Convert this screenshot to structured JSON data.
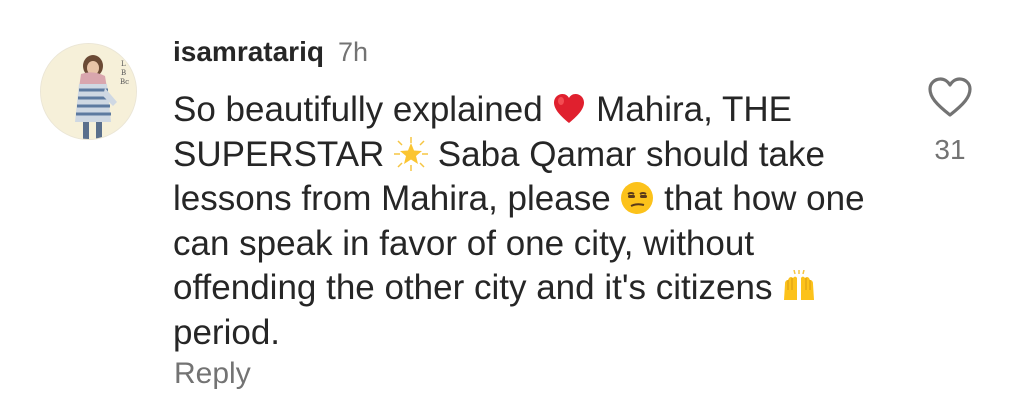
{
  "comment": {
    "avatar_icon": "profile-avatar",
    "username": "isamratariq",
    "time": "7h",
    "text": {
      "part1": "So beautifully explained ",
      "emoji1": "red-heart-emoji",
      "part2": " Mahira, THE SUPERSTAR ",
      "emoji2": "glowing-star-emoji",
      "part3": " Saba Qamar should take lessons from Mahira, please ",
      "emoji3": "unamused-face-emoji",
      "part4": " that how one can speak in favor of one city, without offending the other city and it's citizens ",
      "emoji4": "raising-hands-emoji",
      "part5": " period."
    },
    "reply_label": "Reply",
    "like_icon": "heart-outline-icon",
    "like_count": "31"
  }
}
